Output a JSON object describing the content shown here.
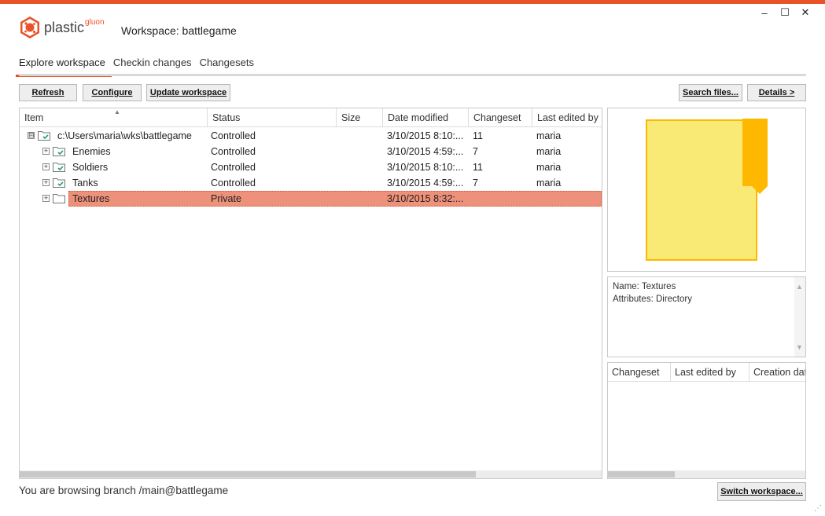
{
  "window": {
    "brand": "plastic",
    "brand_sup": "gluon",
    "workspace_title": "Workspace: battlegame",
    "accent_color": "#e8532a",
    "controls": {
      "minimize": "–",
      "maximize": "☐",
      "close": "✕"
    }
  },
  "tabs": [
    {
      "label": "Explore workspace",
      "active": true
    },
    {
      "label": "Checkin changes",
      "active": false
    },
    {
      "label": "Changesets",
      "active": false
    }
  ],
  "toolbar": {
    "refresh": "Refresh",
    "configure": "Configure",
    "update": "Update workspace",
    "search": "Search files...",
    "details": "Details >"
  },
  "grid": {
    "columns": [
      "Item",
      "Status",
      "Size",
      "Date modified",
      "Changeset",
      "Last edited by"
    ],
    "rows": [
      {
        "item": "c:\\Users\\maria\\wks\\battlegame",
        "status": "Controlled",
        "size": "",
        "date": "3/10/2015 8:10:...",
        "changeset": "11",
        "editor": "maria",
        "icon": "controlled-folder-icon",
        "expander": "⊟",
        "selected": false
      },
      {
        "item": "Enemies",
        "status": "Controlled",
        "size": "",
        "date": "3/10/2015 4:59:...",
        "changeset": "7",
        "editor": "maria",
        "icon": "controlled-folder-icon",
        "expander": "+",
        "selected": false
      },
      {
        "item": "Soldiers",
        "status": "Controlled",
        "size": "",
        "date": "3/10/2015 8:10:...",
        "changeset": "11",
        "editor": "maria",
        "icon": "controlled-folder-icon",
        "expander": "+",
        "selected": false
      },
      {
        "item": "Tanks",
        "status": "Controlled",
        "size": "",
        "date": "3/10/2015 4:59:...",
        "changeset": "7",
        "editor": "maria",
        "icon": "controlled-folder-icon",
        "expander": "+",
        "selected": false
      },
      {
        "item": "Textures",
        "status": "Private",
        "size": "",
        "date": "3/10/2015 8:32:...",
        "changeset": "",
        "editor": "",
        "icon": "private-folder-icon",
        "expander": "+",
        "selected": true
      }
    ]
  },
  "properties": {
    "name": "Name: Textures",
    "attributes": "Attributes: Directory"
  },
  "history": {
    "columns": [
      "Changeset",
      "Last edited by",
      "Creation date"
    ]
  },
  "status_bar": {
    "text": "You are browsing branch /main@battlegame",
    "switch_button": "Switch workspace..."
  }
}
